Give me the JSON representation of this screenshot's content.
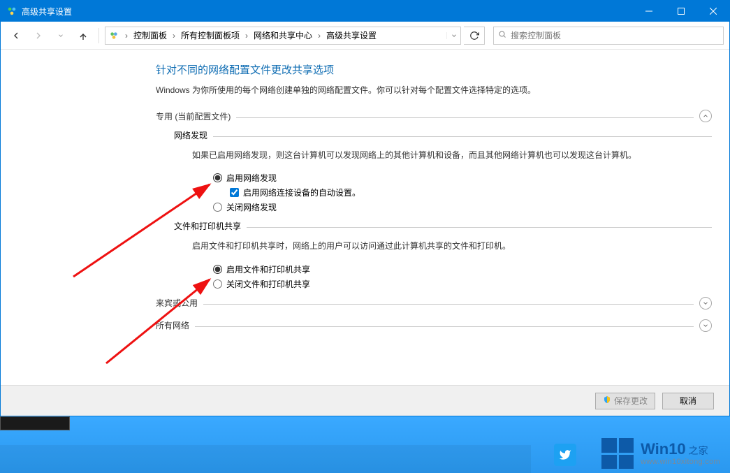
{
  "title": "高级共享设置",
  "breadcrumb": {
    "items": [
      "控制面板",
      "所有控制面板项",
      "网络和共享中心",
      "高级共享设置"
    ]
  },
  "search": {
    "placeholder": "搜索控制面板"
  },
  "page": {
    "heading": "针对不同的网络配置文件更改共享选项",
    "description": "Windows 为你所使用的每个网络创建单独的网络配置文件。你可以针对每个配置文件选择特定的选项。"
  },
  "profiles": {
    "private": {
      "label": "专用 (当前配置文件)",
      "expanded": true,
      "network_discovery": {
        "heading": "网络发现",
        "description": "如果已启用网络发现，则这台计算机可以发现网络上的其他计算机和设备，而且其他网络计算机也可以发现这台计算机。",
        "options": {
          "enable": "启用网络发现",
          "auto_setup": "启用网络连接设备的自动设置。",
          "disable": "关闭网络发现"
        },
        "selected": "enable",
        "auto_checked": true
      },
      "file_printer": {
        "heading": "文件和打印机共享",
        "description": "启用文件和打印机共享时，网络上的用户可以访问通过此计算机共享的文件和打印机。",
        "options": {
          "enable": "启用文件和打印机共享",
          "disable": "关闭文件和打印机共享"
        },
        "selected": "enable"
      }
    },
    "guest": {
      "label": "来宾或公用",
      "expanded": false
    },
    "all": {
      "label": "所有网络",
      "expanded": false
    }
  },
  "footer": {
    "save": "保存更改",
    "cancel": "取消"
  },
  "watermark": {
    "brand": "Win10",
    "suffix": "之家",
    "url": "www.win10xitong.com"
  }
}
